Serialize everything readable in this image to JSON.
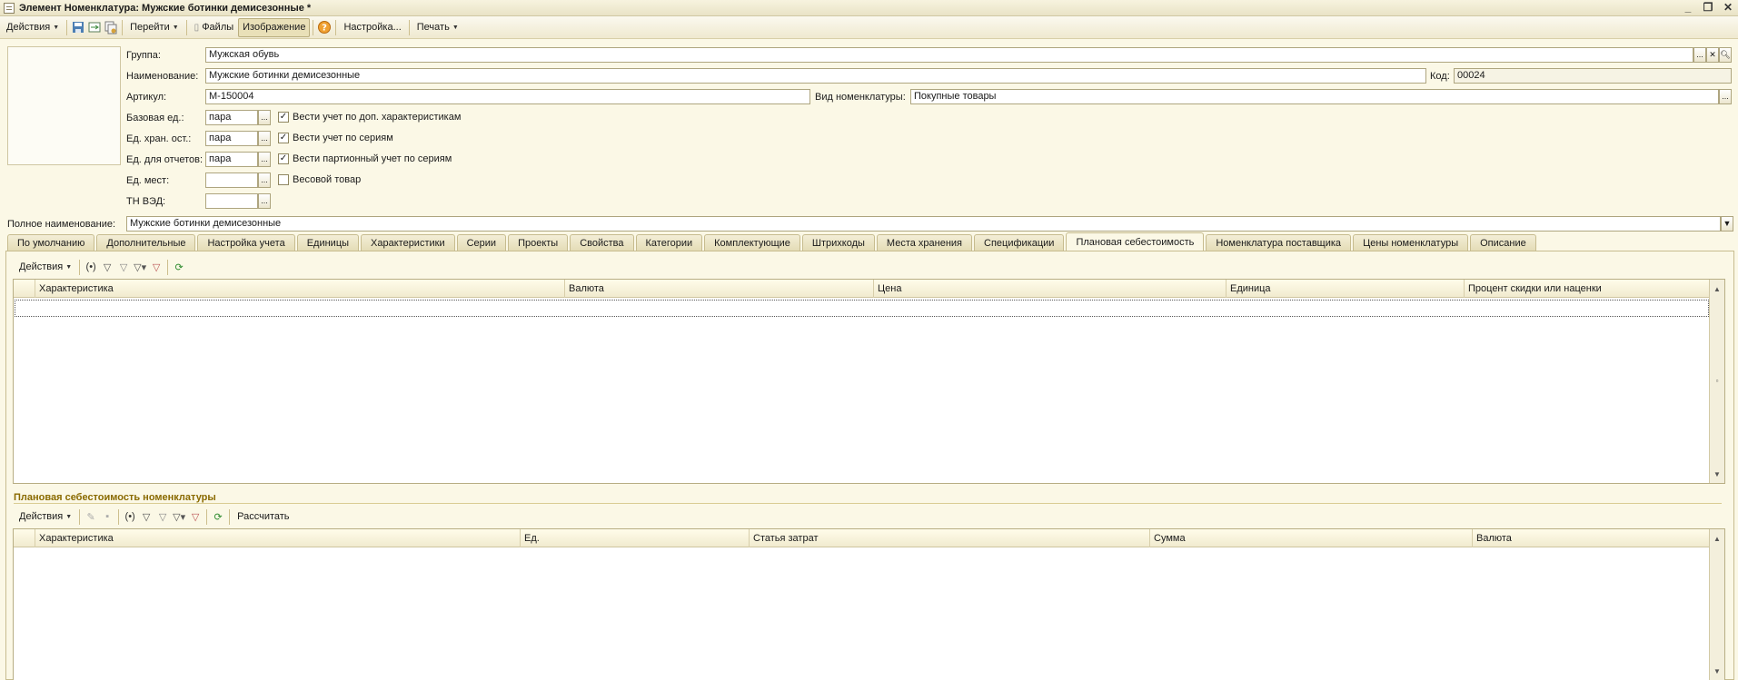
{
  "window": {
    "title": "Элемент Номенклатура: Мужские ботинки демисезонные *"
  },
  "toolbar": {
    "actions": "Действия",
    "goto": "Перейти",
    "files": "Файлы",
    "image": "Изображение",
    "settings": "Настройка...",
    "print": "Печать"
  },
  "form": {
    "group_label": "Группа:",
    "group_value": "Мужская обувь",
    "name_label": "Наименование:",
    "name_value": "Мужские ботинки демисезонные",
    "code_label": "Код:",
    "code_value": "00024",
    "article_label": "Артикул:",
    "article_value": "М-150004",
    "kind_label": "Вид номенклатуры:",
    "kind_value": "Покупные товары",
    "base_unit_label": "Базовая ед.:",
    "base_unit_value": "пара",
    "storage_unit_label": "Ед. хран. ост.:",
    "storage_unit_value": "пара",
    "report_unit_label": "Ед. для отчетов:",
    "report_unit_value": "пара",
    "place_unit_label": "Ед. мест:",
    "place_unit_value": "",
    "tnved_label": "ТН ВЭД:",
    "tnved_value": "",
    "chk_characteristics": "Вести учет по доп. характеристикам",
    "chk_series": "Вести учет по сериям",
    "chk_batch": "Вести партионный учет по сериям",
    "chk_weight": "Весовой товар",
    "fullname_label": "Полное наименование:",
    "fullname_value": "Мужские ботинки демисезонные"
  },
  "tabs": [
    "По умолчанию",
    "Дополнительные",
    "Настройка учета",
    "Единицы",
    "Характеристики",
    "Серии",
    "Проекты",
    "Свойства",
    "Категории",
    "Комплектующие",
    "Штрихкоды",
    "Места хранения",
    "Спецификации",
    "Плановая себестоимость",
    "Номенклатура поставщика",
    "Цены номенклатуры",
    "Описание"
  ],
  "active_tab": "Плановая себестоимость",
  "upper_table": {
    "actions": "Действия",
    "columns": [
      "Характеристика",
      "Валюта",
      "Цена",
      "Единица",
      "Процент скидки или наценки"
    ]
  },
  "lower_section": {
    "title": "Плановая себестоимость номенклатуры",
    "actions": "Действия",
    "calc": "Рассчитать",
    "columns": [
      "Характеристика",
      "Ед.",
      "Статья затрат",
      "Сумма",
      "Валюта"
    ]
  }
}
